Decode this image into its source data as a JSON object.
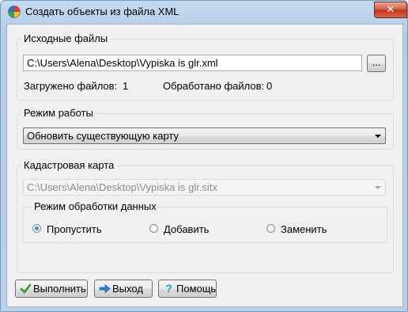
{
  "window": {
    "title": "Создать объекты из файла XML",
    "close_label": "✕"
  },
  "source_files": {
    "group_label": "Исходные файлы",
    "path_value": "C:\\Users\\Alena\\Desktop\\Vypiska is glr.xml",
    "browse_label": "...",
    "loaded_label": "Загружено файлов:",
    "loaded_count": "1",
    "processed_label": "Обработано файлов:",
    "processed_count": "0"
  },
  "mode": {
    "group_label": "Режим работы",
    "selected": "Обновить существующую карту"
  },
  "cadastral": {
    "group_label": "Кадастровая карта",
    "path_value": "C:\\Users\\Alena\\Desktop\\Vypiska is glr.sitx",
    "processing": {
      "group_label": "Режим обработки данных",
      "options": [
        "Пропустить",
        "Добавить",
        "Заменить"
      ],
      "selected_index": 0
    }
  },
  "buttons": {
    "run": "Выполнить",
    "exit": "Выход",
    "help": "Помощь"
  },
  "icons": {
    "run": "check-icon",
    "exit": "arrow-right-icon",
    "help": "question-icon"
  }
}
